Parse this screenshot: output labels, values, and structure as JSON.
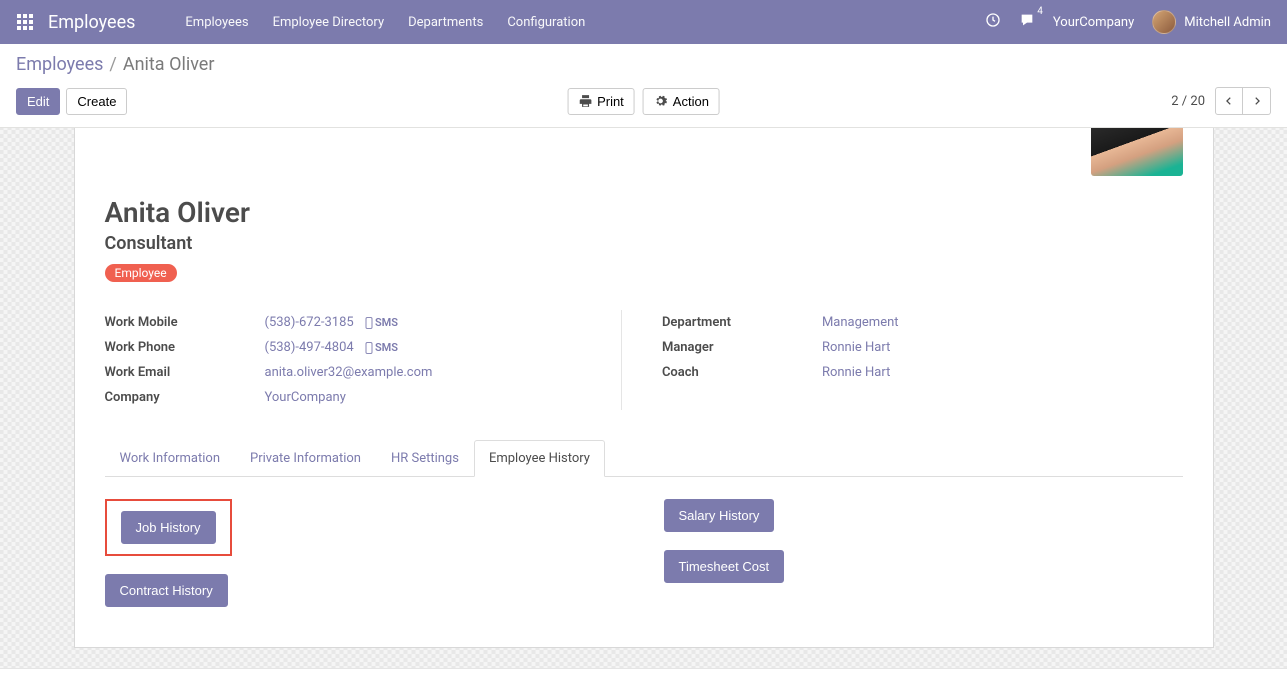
{
  "navbar": {
    "brand": "Employees",
    "menu": [
      "Employees",
      "Employee Directory",
      "Departments",
      "Configuration"
    ],
    "messages_count": "4",
    "company": "YourCompany",
    "user": "Mitchell Admin"
  },
  "breadcrumb": {
    "root": "Employees",
    "sep": "/",
    "current": "Anita Oliver"
  },
  "toolbar": {
    "edit": "Edit",
    "create": "Create",
    "print": "Print",
    "action": "Action",
    "pager": "2 / 20"
  },
  "employee": {
    "name": "Anita Oliver",
    "job_title": "Consultant",
    "tag": "Employee"
  },
  "fields_left": {
    "work_mobile_label": "Work Mobile",
    "work_mobile": "(538)-672-3185",
    "work_phone_label": "Work Phone",
    "work_phone": "(538)-497-4804",
    "work_email_label": "Work Email",
    "work_email": "anita.oliver32@example.com",
    "company_label": "Company",
    "company": "YourCompany",
    "sms": "SMS"
  },
  "fields_right": {
    "department_label": "Department",
    "department": "Management",
    "manager_label": "Manager",
    "manager": "Ronnie Hart",
    "coach_label": "Coach",
    "coach": "Ronnie Hart"
  },
  "tabs": {
    "work_info": "Work Information",
    "private_info": "Private Information",
    "hr_settings": "HR Settings",
    "history": "Employee History"
  },
  "history_buttons": {
    "job": "Job History",
    "contract": "Contract History",
    "salary": "Salary History",
    "timesheet": "Timesheet Cost"
  }
}
